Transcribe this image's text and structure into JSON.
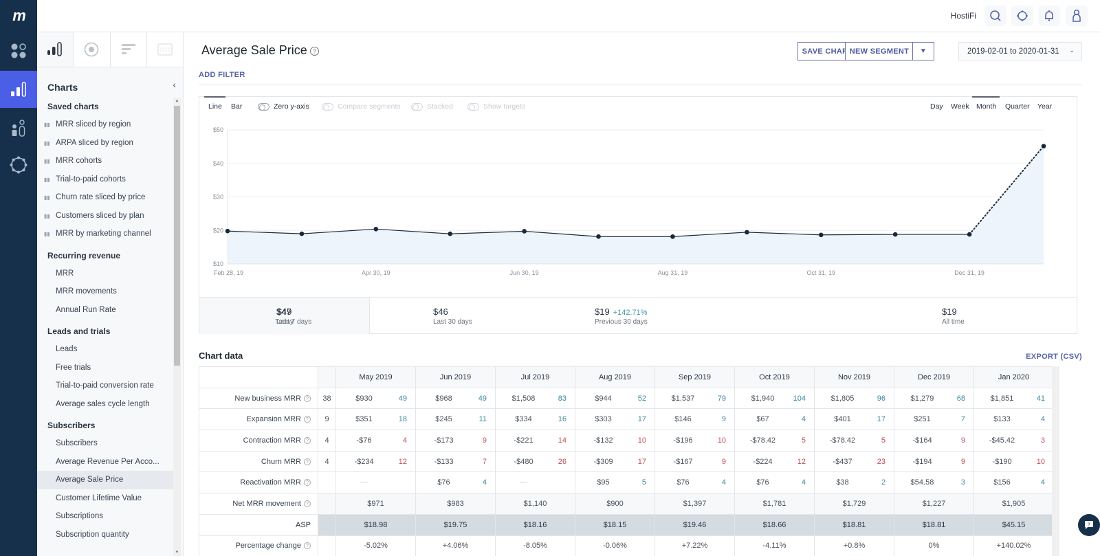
{
  "app": {
    "logo": "m",
    "account": "HostiFi"
  },
  "rail": {
    "items": [
      {
        "name": "dashboards",
        "icon": "dashboard-grid-icon",
        "active": false
      },
      {
        "name": "charts",
        "icon": "bar-chart-icon",
        "active": true
      },
      {
        "name": "customers",
        "icon": "people-icon",
        "active": false
      },
      {
        "name": "settings",
        "icon": "gear-icon",
        "active": false
      }
    ]
  },
  "topbar": {
    "icons": [
      "search-icon",
      "crosshair-icon",
      "bell-icon",
      "user-icon"
    ]
  },
  "sidebar": {
    "tabs": [
      "charts-tab",
      "goals-tab",
      "reports-tab",
      "benchmarks-tab"
    ],
    "heading": "Charts",
    "sections": [
      {
        "title": "Saved charts",
        "saved": true,
        "items": [
          "MRR sliced by region",
          "ARPA sliced by region",
          "MRR cohorts",
          "Trial-to-paid cohorts",
          "Churn rate sliced by price",
          "Customers sliced by plan",
          "MRR by marketing channel"
        ]
      },
      {
        "title": "Recurring revenue",
        "items": [
          "MRR",
          "MRR movements",
          "Annual Run Rate"
        ]
      },
      {
        "title": "Leads and trials",
        "items": [
          "Leads",
          "Free trials",
          "Trial-to-paid conversion rate",
          "Average sales cycle length"
        ]
      },
      {
        "title": "Subscribers",
        "items": [
          "Subscribers",
          "Average Revenue Per Acco...",
          "Average Sale Price",
          "Customer Lifetime Value",
          "Subscriptions",
          "Subscription quantity"
        ]
      }
    ],
    "active_item": "Average Sale Price"
  },
  "header": {
    "title": "Average Sale Price",
    "save_chart": "SAVE CHART",
    "new_segment": "NEW SEGMENT",
    "date_range": "2019-02-01 to 2020-01-31",
    "add_filter": "ADD FILTER"
  },
  "controls": {
    "type_tabs": [
      "Line",
      "Bar"
    ],
    "active_type": "Line",
    "toggles": [
      {
        "label": "Zero y-axis",
        "enabled": true,
        "on": false
      },
      {
        "label": "Compare segments",
        "enabled": false,
        "on": false
      },
      {
        "label": "Stacked",
        "enabled": false,
        "on": false
      },
      {
        "label": "Show targets",
        "enabled": false,
        "on": false
      }
    ],
    "intervals": [
      "Day",
      "Week",
      "Month",
      "Quarter",
      "Year"
    ],
    "active_interval": "Month"
  },
  "chart_data": {
    "type": "area",
    "title": "Average Sale Price",
    "x": [
      "Feb 28, 19",
      "Mar 31, 19",
      "Apr 30, 19",
      "May 31, 19",
      "Jun 30, 19",
      "Jul 31, 19",
      "Aug 31, 19",
      "Sep 30, 19",
      "Oct 31, 19",
      "Nov 30, 19",
      "Dec 31, 19",
      "Jan 31, 20"
    ],
    "x_tick_labels": [
      "Feb 28, 19",
      "Apr 30, 19",
      "Jun 30, 19",
      "Aug 31, 19",
      "Oct 31, 19",
      "Dec 31, 19"
    ],
    "series": [
      {
        "name": "ASP",
        "values": [
          19.8,
          19.0,
          20.4,
          18.98,
          19.75,
          18.16,
          18.15,
          19.46,
          18.66,
          18.81,
          18.81,
          45.15
        ],
        "projected_last_segment": true
      }
    ],
    "y_ticks": [
      "$10",
      "$20",
      "$30",
      "$40",
      "$50"
    ],
    "ylim": [
      10,
      50
    ],
    "grid": true,
    "legend": "none"
  },
  "stats": [
    {
      "value": "$49",
      "label": "Today",
      "change": ""
    },
    {
      "value": "$47",
      "label": "Last 7 days",
      "change": ""
    },
    {
      "value": "$46",
      "label": "Last 30 days",
      "change": ""
    },
    {
      "value": "$19",
      "label": "Previous 30 days",
      "change": "+142.71%"
    },
    {
      "value": "$19",
      "label": "All time",
      "change": ""
    }
  ],
  "chart_table": {
    "title": "Chart data",
    "export": "EXPORT (CSV)",
    "months": [
      "May 2019",
      "Jun 2019",
      "Jul 2019",
      "Aug 2019",
      "Sep 2019",
      "Oct 2019",
      "Nov 2019",
      "Dec 2019",
      "Jan 2020"
    ],
    "rows": [
      {
        "label": "New business MRR",
        "help": true,
        "kind": "pos",
        "prev": "38",
        "cells": [
          [
            "$930",
            "49"
          ],
          [
            "$968",
            "49"
          ],
          [
            "$1,508",
            "83"
          ],
          [
            "$944",
            "52"
          ],
          [
            "$1,537",
            "79"
          ],
          [
            "$1,940",
            "104"
          ],
          [
            "$1,805",
            "96"
          ],
          [
            "$1,279",
            "68"
          ],
          [
            "$1,851",
            "41"
          ]
        ]
      },
      {
        "label": "Expansion MRR",
        "help": true,
        "kind": "pos",
        "prev": "9",
        "cells": [
          [
            "$351",
            "18"
          ],
          [
            "$245",
            "11"
          ],
          [
            "$334",
            "16"
          ],
          [
            "$303",
            "17"
          ],
          [
            "$146",
            "9"
          ],
          [
            "$67",
            "4"
          ],
          [
            "$401",
            "17"
          ],
          [
            "$251",
            "7"
          ],
          [
            "$133",
            "4"
          ]
        ]
      },
      {
        "label": "Contraction MRR",
        "help": true,
        "kind": "neg",
        "prev": "4",
        "cells": [
          [
            "-$76",
            "4"
          ],
          [
            "-$173",
            "9"
          ],
          [
            "-$221",
            "14"
          ],
          [
            "-$132",
            "10"
          ],
          [
            "-$196",
            "10"
          ],
          [
            "-$78.42",
            "5"
          ],
          [
            "-$78.42",
            "5"
          ],
          [
            "-$164",
            "9"
          ],
          [
            "-$45.42",
            "3"
          ]
        ]
      },
      {
        "label": "Churn MRR",
        "help": true,
        "kind": "neg",
        "prev": "4",
        "cells": [
          [
            "-$234",
            "12"
          ],
          [
            "-$133",
            "7"
          ],
          [
            "-$480",
            "26"
          ],
          [
            "-$309",
            "17"
          ],
          [
            "-$167",
            "9"
          ],
          [
            "-$224",
            "12"
          ],
          [
            "-$437",
            "23"
          ],
          [
            "-$194",
            "9"
          ],
          [
            "-$190",
            "10"
          ]
        ]
      },
      {
        "label": "Reactivation MRR",
        "help": true,
        "kind": "pos",
        "prev": "",
        "cells": [
          [
            "—",
            ""
          ],
          [
            "$76",
            "4"
          ],
          [
            "—",
            ""
          ],
          [
            "$95",
            "5"
          ],
          [
            "$76",
            "4"
          ],
          [
            "$76",
            "4"
          ],
          [
            "$38",
            "2"
          ],
          [
            "$54.58",
            "3"
          ],
          [
            "$156",
            "4"
          ]
        ]
      }
    ],
    "net_row": {
      "label": "Net MRR movement",
      "values": [
        "$971",
        "$983",
        "$1,140",
        "$900",
        "$1,397",
        "$1,781",
        "$1,729",
        "$1,227",
        "$1,905"
      ]
    },
    "asp_row": {
      "label": "ASP",
      "values": [
        "$18.98",
        "$19.75",
        "$18.16",
        "$18.15",
        "$19.46",
        "$18.66",
        "$18.81",
        "$18.81",
        "$45.15"
      ]
    },
    "pct_row": {
      "label": "Percentage change",
      "values": [
        "-5.02%",
        "+4.06%",
        "-8.05%",
        "-0.06%",
        "+7.22%",
        "-4.11%",
        "+0.8%",
        "0%",
        "+140.02%"
      ]
    }
  }
}
